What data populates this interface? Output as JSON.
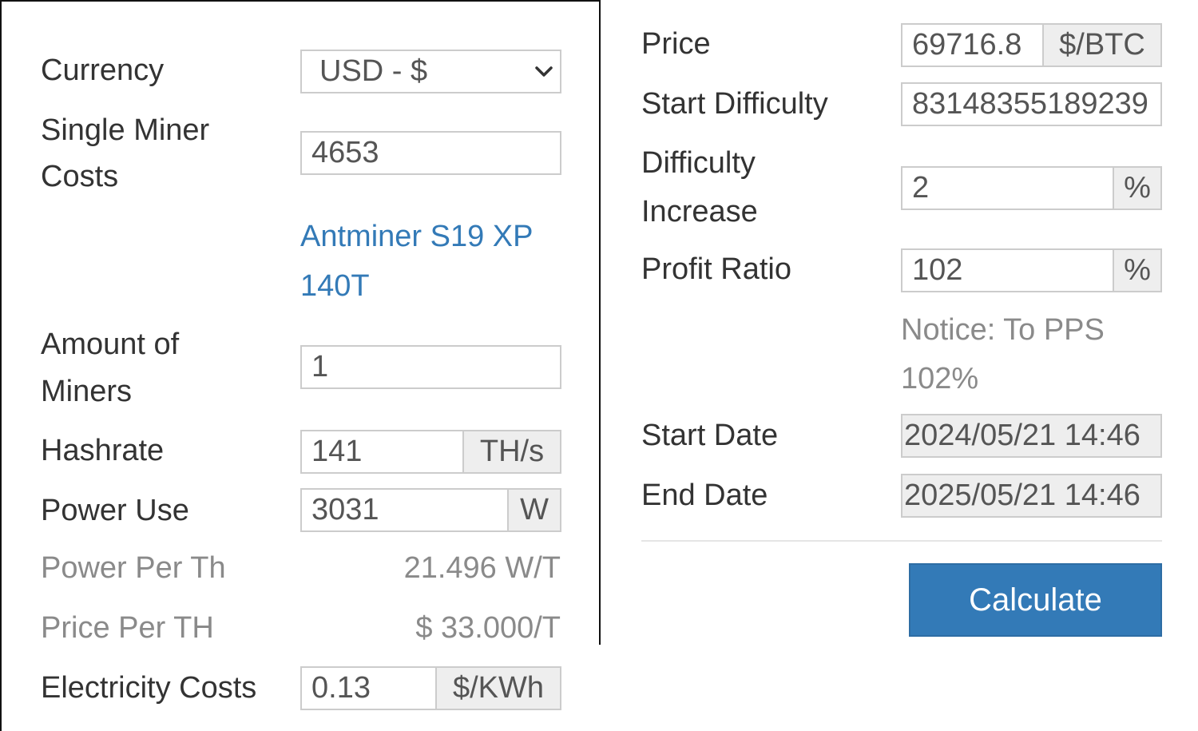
{
  "left": {
    "currency": {
      "label": "Currency",
      "value": "USD - $"
    },
    "single_miner_costs": {
      "label_line1": "Single Miner",
      "label_line2": "Costs",
      "value": "4653"
    },
    "miner_link": {
      "line1": "Antminer S19 XP",
      "line2": "140T"
    },
    "amount_of_miners": {
      "label_line1": "Amount of",
      "label_line2": "Miners",
      "value": "1"
    },
    "hashrate": {
      "label": "Hashrate",
      "value": "141",
      "unit": "TH/s"
    },
    "power_use": {
      "label": "Power Use",
      "value": "3031",
      "unit": "W"
    },
    "power_per_th": {
      "label": "Power Per Th",
      "value": "21.496 W/T"
    },
    "price_per_th": {
      "label": "Price Per TH",
      "value": "$ 33.000/T"
    },
    "electricity_costs": {
      "label": "Electricity Costs",
      "value": "0.13",
      "unit": "$/KWh"
    }
  },
  "right": {
    "price": {
      "label": "Price",
      "value": "69716.8",
      "unit": "$/BTC"
    },
    "start_difficulty": {
      "label": "Start Difficulty",
      "value": "83148355189239"
    },
    "difficulty_increase": {
      "label_line1": "Difficulty",
      "label_line2": "Increase",
      "value": "2",
      "unit": "%"
    },
    "profit_ratio": {
      "label": "Profit Ratio",
      "value": "102",
      "unit": "%"
    },
    "notice": {
      "line1": "Notice: To PPS",
      "line2": "102%"
    },
    "start_date": {
      "label": "Start Date",
      "value": "2024/05/21 14:46"
    },
    "end_date": {
      "label": "End Date",
      "value": "2025/05/21 14:46"
    },
    "calculate_button": "Calculate"
  },
  "colors": {
    "link": "#337ab7",
    "button": "#337ab7",
    "muted_text": "#8a8a8a",
    "addon_bg": "#eeeeee"
  },
  "icons": {
    "currency_dropdown": "chevron-down-icon"
  }
}
